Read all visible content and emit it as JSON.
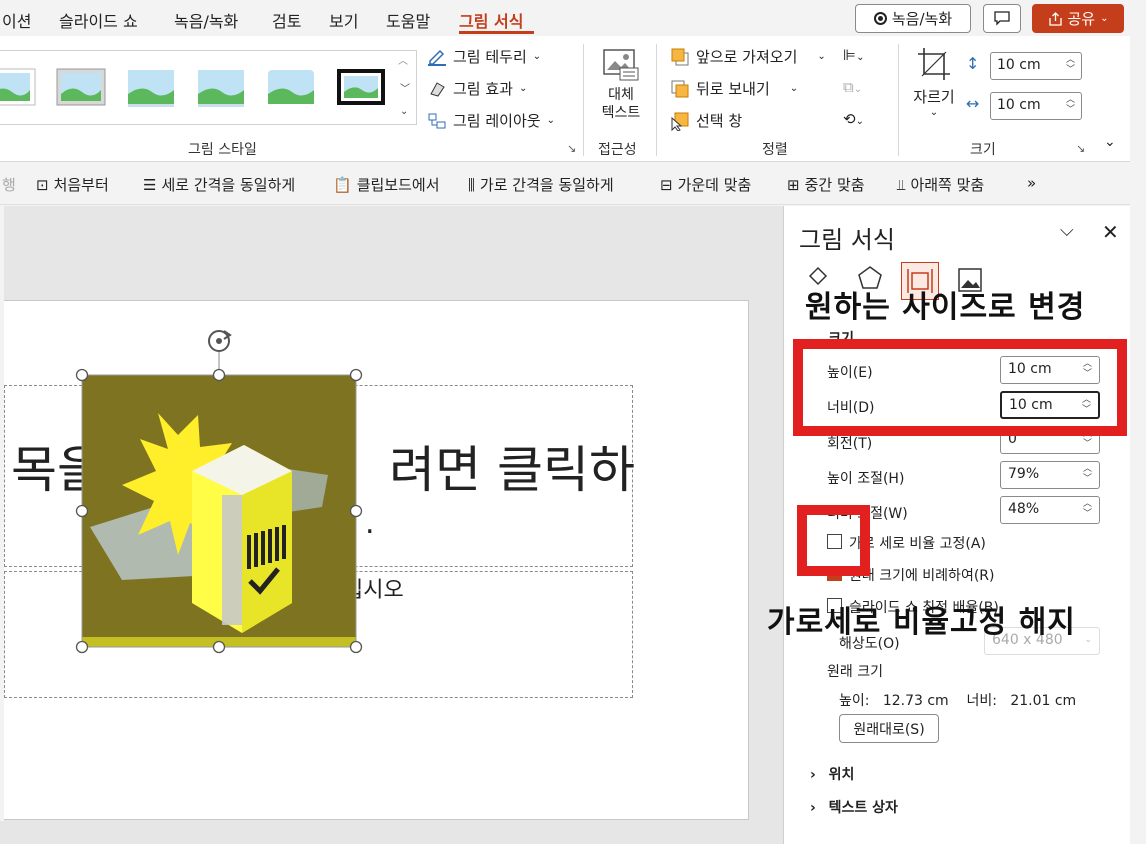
{
  "menu": {
    "tabs": [
      "이션",
      "슬라이드 쇼",
      "녹음/녹화",
      "검토",
      "보기",
      "도움말",
      "그림 서식"
    ],
    "record_button": "녹음/녹화",
    "share_button": "공유"
  },
  "ribbon": {
    "picture_styles_label": "그림 스타일",
    "border_label": "그림 테두리",
    "effects_label": "그림 효과",
    "layout_label": "그림 레이아웃",
    "alt_text_line1": "대체",
    "alt_text_line2": "텍스트",
    "accessibility_label": "접근성",
    "bring_forward": "앞으로 가져오기",
    "send_backward": "뒤로 보내기",
    "selection_pane": "선택 창",
    "arrange_label": "정렬",
    "crop_label": "자르기",
    "height_value": "10 cm",
    "width_value": "10 cm",
    "size_label": "크기"
  },
  "qat": {
    "items": [
      "처음부터",
      "세로 간격을 동일하게",
      "클립보드에서",
      "가로 간격을 동일하게",
      "가운데 맞춤",
      "중간 맞춤",
      "아래쪽 맞춤"
    ],
    "partial_left": "행",
    "more": "»"
  },
  "slide": {
    "title_text": "목을                  려면 클릭하",
    "title_text_part2": ".",
    "subtitle_text": "십시오"
  },
  "pane": {
    "title": "그림 서식",
    "section_size": "크기",
    "height_label": "높이(E)",
    "height_value": "10 cm",
    "width_label": "너비(D)",
    "width_value": "10 cm",
    "rotation_label": "회전(T)",
    "rotation_value": "0",
    "scale_height_label": "높이 조절(H)",
    "scale_height_value": "79%",
    "scale_width_label": "너비 조절(W)",
    "scale_width_value": "48%",
    "lock_aspect_label": "가로 세로 비율 고정(A)",
    "relative_label": "원래 크기에 비례하여(R)",
    "best_scale_label": "슬라이드 쇼 최적 배율(B)",
    "resolution_label": "해상도(O)",
    "resolution_value": "640 x 480",
    "original_size_label": "원래 크기",
    "original_size_text": "높이:   12.73 cm    너비:   21.01 cm",
    "reset_button": "원래대로(S)",
    "position_section": "위치",
    "textbox_section": "텍스트 상자"
  },
  "annotations": {
    "top_note": "원하는 사이즈로 변경",
    "bottom_note": "가로세로 비율고정 해지"
  },
  "colors": {
    "accent": "#c43e1c",
    "annotation_red": "#e32020",
    "image_bg": "#7d7320"
  }
}
